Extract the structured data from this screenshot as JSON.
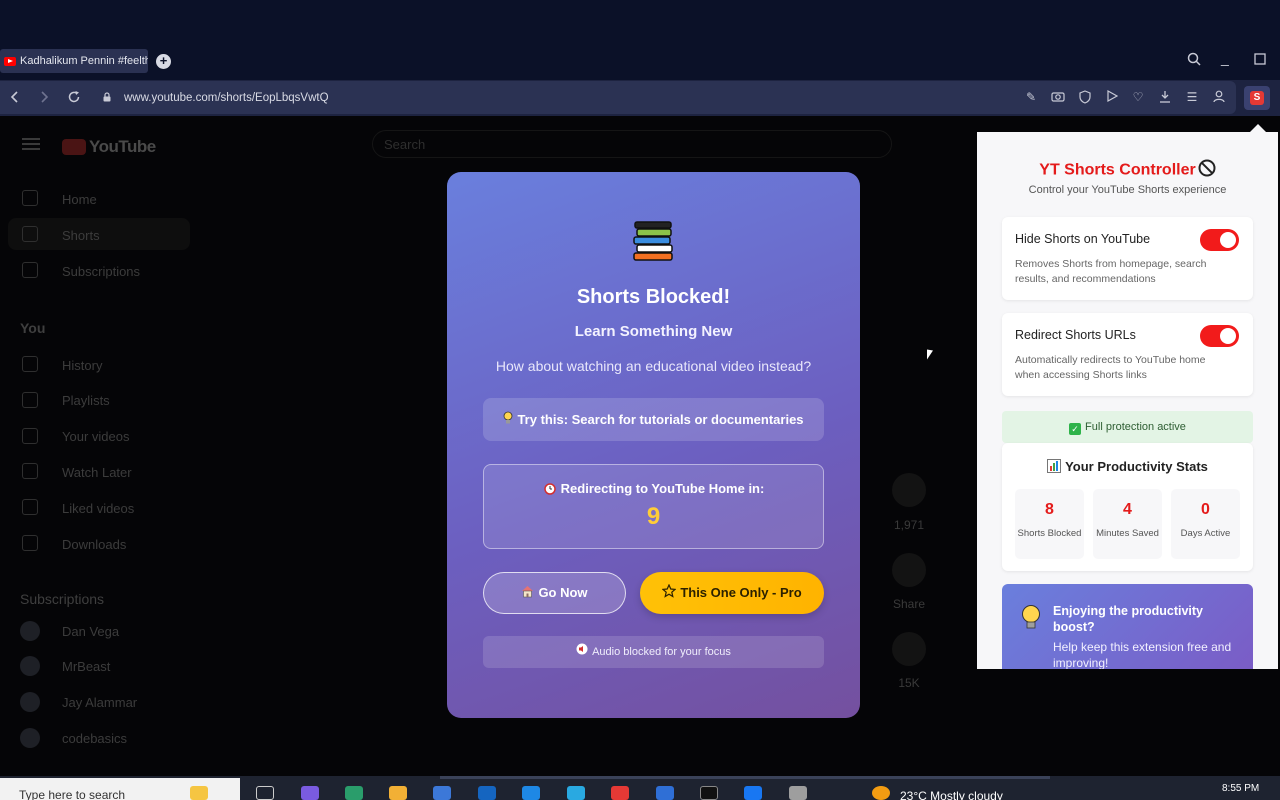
{
  "browser": {
    "tab_title": "Kadhalikum Pennin #feelthebeat",
    "url": "www.youtube.com/shorts/EopLbqsVwtQ"
  },
  "youtube": {
    "logo_text": "YouTube",
    "search_placeholder": "Search",
    "nav": [
      "Home",
      "Shorts",
      "Subscriptions"
    ],
    "you_heading": "You",
    "you_items": [
      "History",
      "Playlists",
      "Your videos",
      "Watch Later",
      "Liked videos",
      "Downloads"
    ],
    "subs_heading": "Subscriptions",
    "subs": [
      "Dan Vega",
      "MrBeast",
      "Jay Alammar",
      "codebasics"
    ],
    "actions": {
      "comments": "1,971",
      "share": "Share",
      "remix": "15K"
    }
  },
  "overlay": {
    "title": "Shorts Blocked!",
    "subtitle": "Learn Something New",
    "question": "How about watching an educational video instead?",
    "tip": "Try this: Search for tutorials or documentaries",
    "redirect_label": "Redirecting to YouTube Home in:",
    "countdown": "9",
    "go_now": "Go Now",
    "this_one_pro": "This One Only - Pro",
    "audio_note": "Audio blocked for your focus"
  },
  "extension": {
    "title": "YT Shorts Controller",
    "subtitle": "Control your YouTube Shorts experience",
    "settings": [
      {
        "label": "Hide Shorts on YouTube",
        "desc": "Removes Shorts from homepage, search results, and recommendations",
        "on": true
      },
      {
        "label": "Redirect Shorts URLs",
        "desc": "Automatically redirects to YouTube home when accessing Shorts links",
        "on": true
      }
    ],
    "protection": "Full protection active",
    "stats_title": "Your Productivity Stats",
    "stats": [
      {
        "value": "8",
        "label": "Shorts Blocked"
      },
      {
        "value": "4",
        "label": "Minutes Saved"
      },
      {
        "value": "0",
        "label": "Days Active"
      }
    ],
    "promo_title": "Enjoying the productivity boost?",
    "promo_text": "Help keep this extension free and improving!",
    "accent": "#e41b1b"
  },
  "taskbar": {
    "search_placeholder": "Type here to search",
    "weather": "23°C  Mostly cloudy",
    "time": "8:55 PM"
  }
}
